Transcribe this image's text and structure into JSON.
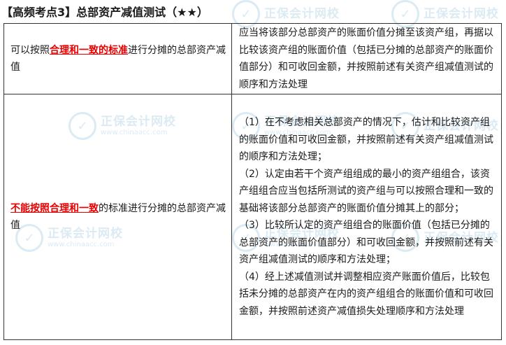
{
  "title": "【高频考点3】总部资产减值测试（★★）",
  "watermark": {
    "brand": "正保会计网校",
    "url": "www.chinaacc.com"
  },
  "rows": [
    {
      "left": {
        "prefix": "可以按照",
        "highlight": "合理和一致的标准",
        "suffix": "进行分摊的总部资产减值"
      },
      "right": [
        "应当将该部分总部资产的账面价值分摊至该资产组，再据以比较该资产组的账面价值（包括已分摊的总部资产的账面价值部分）和可收回金额，并按照前述有关资产组减值测试的顺序和方法处理"
      ]
    },
    {
      "left": {
        "prefix": "",
        "highlight": "不能按照合理和一致",
        "suffix": "的标准进行分摊的总部资产减值"
      },
      "right": [
        "（1）在不考虑相关总部资产的情况下，估计和比较资产组的账面价值和可收回金额，并按照前述有关资产组减值测试的顺序和方法处理；",
        "（2）认定由若干个资产组组成的最小的资产组组合，该资产组组合应当包括所测试的资产组与可以按照合理和一致的基础将该部分总部资产的账面价值分摊其上的部分；",
        "（3）比较所认定的资产组组合的账面价值（包括已分摊的总部资产的账面价值部分）和可收回金额，并按照前述有关资产组减值测试的顺序和方法处理；",
        "（4）经上述减值测试并调整相应资产账面价值后，比较包括未分摊的总部资产在内的资产组组合的账面价值和可收回金额，并按照前述资产减值损失处理顺序和方法处理"
      ]
    }
  ],
  "colors": {
    "highlight": "#e60000",
    "border": "#333333",
    "watermark": "#7fb7d6"
  }
}
